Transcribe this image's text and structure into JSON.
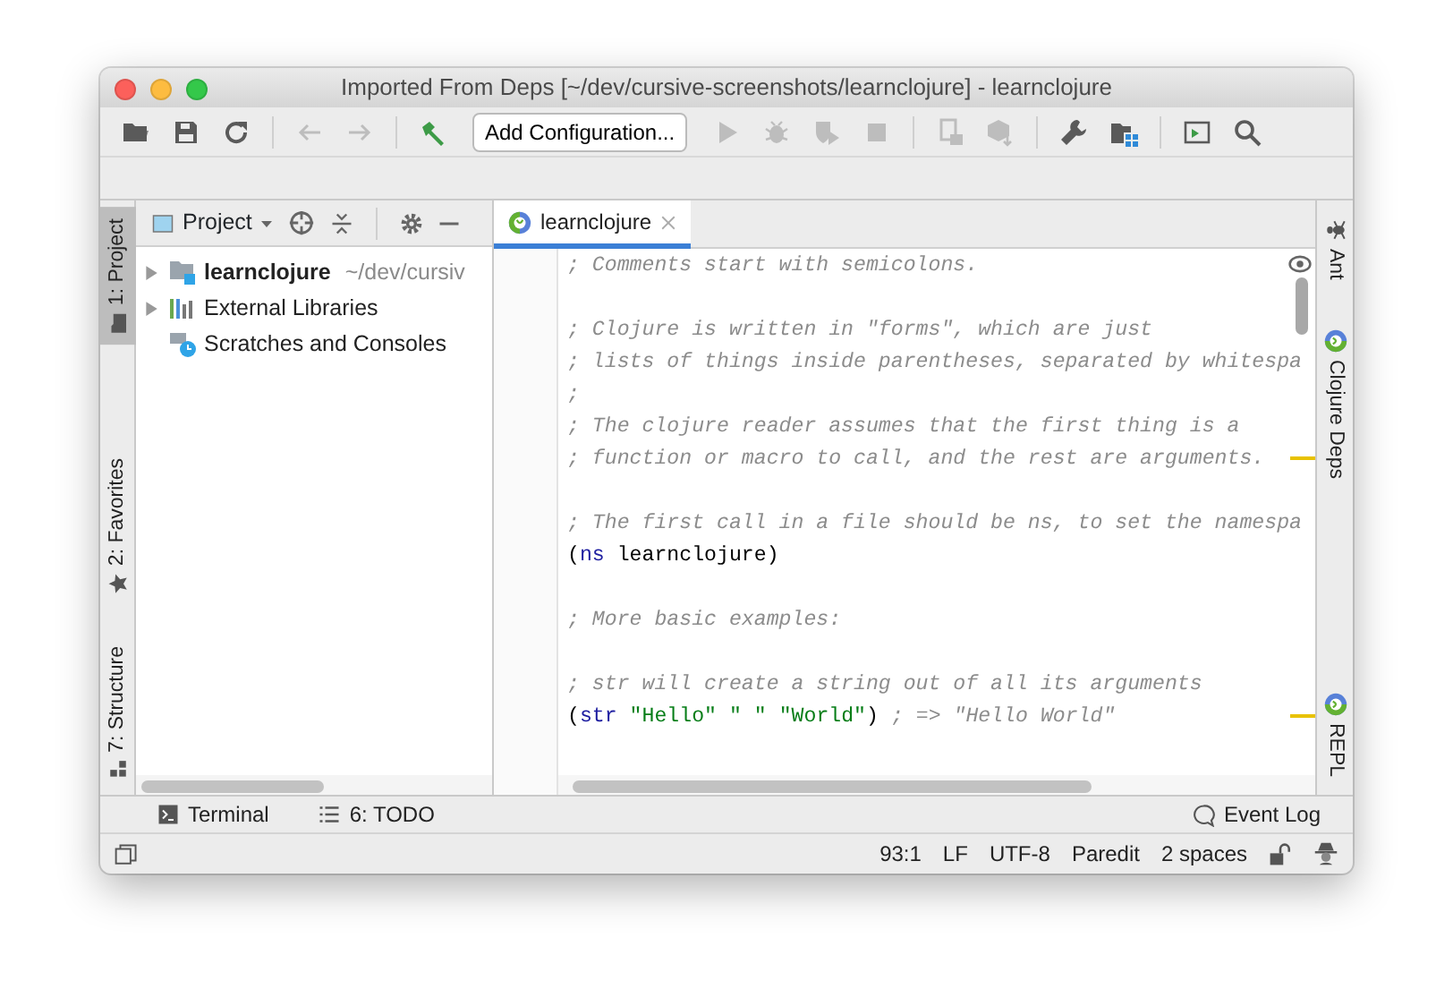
{
  "window": {
    "title": "Imported From Deps [~/dev/cursive-screenshots/learnclojure] - learnclojure"
  },
  "toolbar": [
    {
      "kind": "open",
      "disabled": false
    },
    {
      "kind": "save",
      "disabled": false
    },
    {
      "kind": "sync",
      "disabled": false
    },
    {
      "kind": "separator"
    },
    {
      "kind": "back",
      "disabled": true
    },
    {
      "kind": "forward",
      "disabled": true
    },
    {
      "kind": "separator"
    },
    {
      "kind": "hammer",
      "disabled": false
    },
    {
      "kind": "config",
      "label": "Add Configuration..."
    },
    {
      "kind": "run",
      "disabled": true
    },
    {
      "kind": "debug",
      "disabled": true
    },
    {
      "kind": "coverage",
      "disabled": true
    },
    {
      "kind": "stop",
      "disabled": true
    },
    {
      "kind": "separator"
    },
    {
      "kind": "device",
      "disabled": true
    },
    {
      "kind": "cube",
      "disabled": true
    },
    {
      "kind": "separator"
    },
    {
      "kind": "wrench",
      "disabled": false
    },
    {
      "kind": "structure",
      "disabled": false
    },
    {
      "kind": "separator"
    },
    {
      "kind": "terminal",
      "disabled": false
    },
    {
      "kind": "search",
      "disabled": false
    }
  ],
  "left_tool_tabs": {
    "top": [
      {
        "label": "1: Project",
        "kind": "folder",
        "selected": true
      }
    ],
    "bottom": [
      {
        "label": "2: Favorites",
        "kind": "star",
        "selected": false
      },
      {
        "label": "7: Structure",
        "kind": "structure",
        "selected": false
      }
    ]
  },
  "project_panel": {
    "view": "Project",
    "tree": [
      {
        "kind": "module",
        "label": "learnclojure",
        "hint": "~/dev/cursiv",
        "expanded": false
      },
      {
        "kind": "libraries",
        "label": "External Libraries",
        "expanded": false
      },
      {
        "kind": "scratches",
        "label": "Scratches and Consoles"
      }
    ]
  },
  "editor": {
    "tabs": [
      {
        "label": "learnclojure",
        "selected": true
      }
    ],
    "lines": [
      {
        "marker": false,
        "tokens": [
          {
            "kind": "comment",
            "text": "; Comments start with semicolons."
          }
        ]
      },
      {
        "marker": false
      },
      {
        "marker": false,
        "tokens": [
          {
            "kind": "comment",
            "text": "; Clojure is written in \"forms\", which are just"
          }
        ]
      },
      {
        "marker": false,
        "tokens": [
          {
            "kind": "comment",
            "text": "; lists of things inside parentheses, separated by whitespa"
          }
        ]
      },
      {
        "marker": false,
        "tokens": [
          {
            "kind": "comment",
            "text": ";"
          }
        ]
      },
      {
        "marker": false,
        "tokens": [
          {
            "kind": "comment",
            "text": "; The clojure reader assumes that the first thing is a"
          }
        ]
      },
      {
        "marker": true,
        "tokens": [
          {
            "kind": "comment",
            "text": "; function or macro to call, and the rest are arguments."
          }
        ]
      },
      {
        "marker": false
      },
      {
        "marker": false,
        "tokens": [
          {
            "kind": "comment",
            "text": "; The first call in a file should be ns, to set the namespa"
          }
        ]
      },
      {
        "marker": false,
        "tokens": [
          {
            "kind": "plain",
            "text": "("
          },
          {
            "kind": "keyword",
            "text": "ns"
          },
          {
            "kind": "plain",
            "text": " learnclojure)"
          }
        ]
      },
      {
        "marker": false
      },
      {
        "marker": false,
        "tokens": [
          {
            "kind": "comment",
            "text": "; More basic examples:"
          }
        ]
      },
      {
        "marker": false
      },
      {
        "marker": false,
        "tokens": [
          {
            "kind": "comment",
            "text": "; str will create a string out of all its arguments"
          }
        ]
      },
      {
        "marker": true,
        "tokens": [
          {
            "kind": "plain",
            "text": "("
          },
          {
            "kind": "keyword",
            "text": "str"
          },
          {
            "kind": "string",
            "text": " \"Hello\""
          },
          {
            "kind": "string",
            "text": " \" \""
          },
          {
            "kind": "string",
            "text": " \"World\""
          },
          {
            "kind": "plain",
            "text": ") "
          },
          {
            "kind": "comment",
            "text": "; => \"Hello World\""
          }
        ]
      }
    ]
  },
  "right_tool_tabs": {
    "top": [
      {
        "label": "Ant",
        "kind": "ant"
      },
      {
        "label": "Clojure Deps",
        "kind": "clojure"
      }
    ],
    "bottom": [
      {
        "label": "REPL",
        "kind": "clojure"
      }
    ]
  },
  "bottom_tool_tabs": {
    "left": [
      {
        "label": "Terminal",
        "kind": "terminal"
      },
      {
        "label": "6: TODO",
        "kind": "list"
      }
    ],
    "right": [
      {
        "label": "Event Log",
        "kind": "bubble"
      }
    ]
  },
  "status_bar": {
    "items": [
      "93:1",
      "LF",
      "UTF-8",
      "Paredit",
      "2 spaces"
    ]
  }
}
